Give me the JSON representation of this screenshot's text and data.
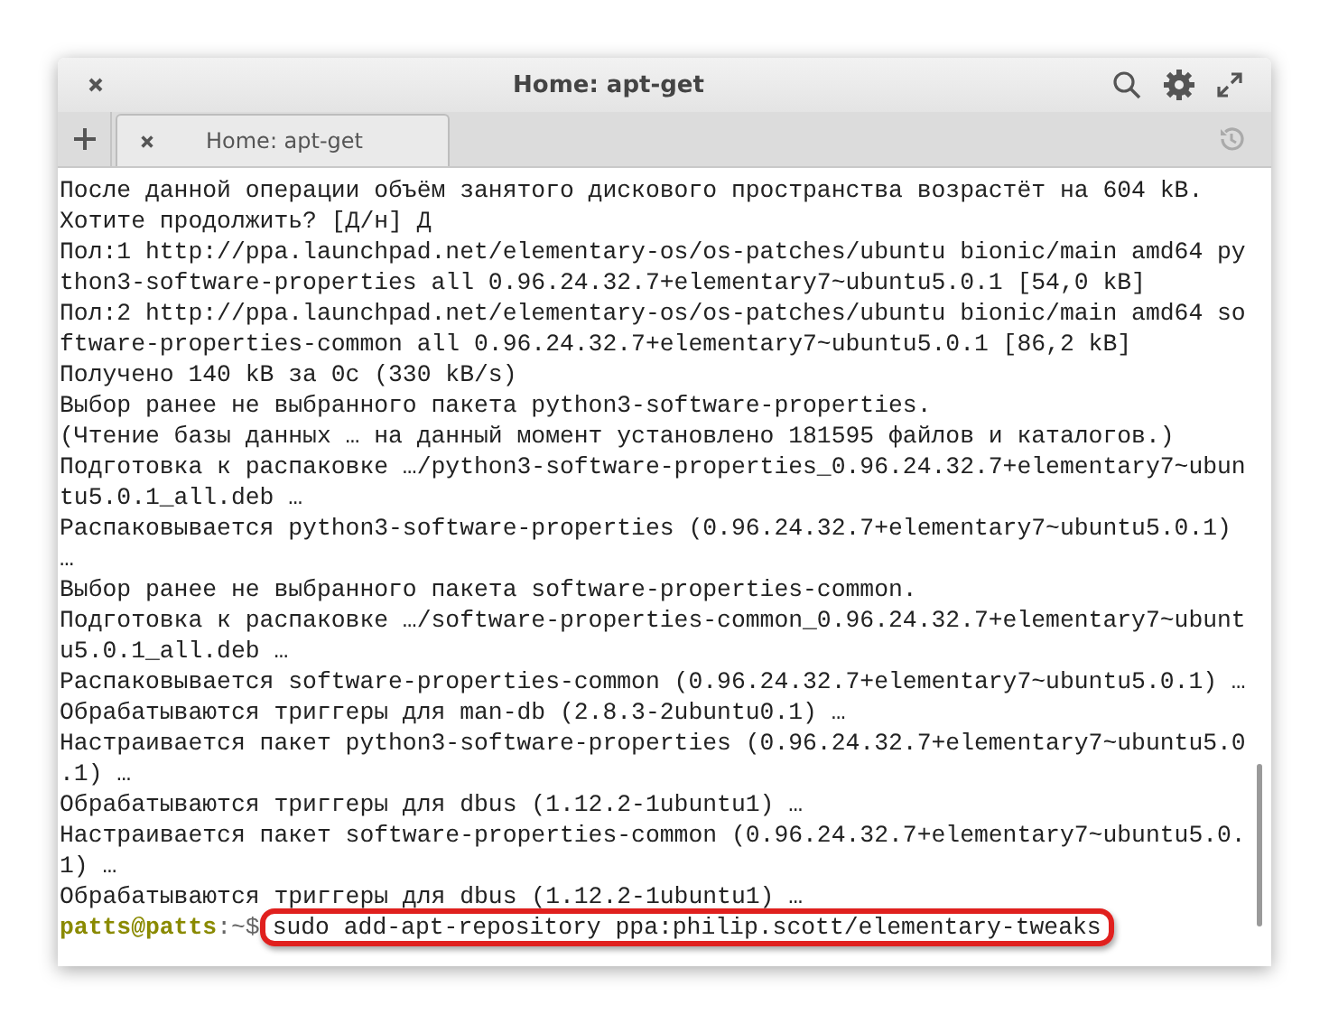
{
  "window": {
    "title": "Home: apt-get"
  },
  "tabs": [
    {
      "label": "Home: apt-get",
      "selected": true
    }
  ],
  "terminal": {
    "lines": [
      "После данной операции объём занятого дискового пространства возрастёт на 604 kB.",
      "Хотите продолжить? [Д/н] Д",
      "Пол:1 http://ppa.launchpad.net/elementary-os/os-patches/ubuntu bionic/main amd64 py",
      "thon3-software-properties all 0.96.24.32.7+elementary7~ubuntu5.0.1 [54,0 kB]",
      "Пол:2 http://ppa.launchpad.net/elementary-os/os-patches/ubuntu bionic/main amd64 so",
      "ftware-properties-common all 0.96.24.32.7+elementary7~ubuntu5.0.1 [86,2 kB]",
      "Получено 140 kB за 0c (330 kB/s)",
      "Выбор ранее не выбранного пакета python3-software-properties.",
      "(Чтение базы данных … на данный момент установлено 181595 файлов и каталогов.)",
      "Подготовка к распаковке …/python3-software-properties_0.96.24.32.7+elementary7~ubun",
      "tu5.0.1_all.deb …",
      "Распаковывается python3-software-properties (0.96.24.32.7+elementary7~ubuntu5.0.1)",
      "…",
      "Выбор ранее не выбранного пакета software-properties-common.",
      "Подготовка к распаковке …/software-properties-common_0.96.24.32.7+elementary7~ubunt",
      "u5.0.1_all.deb …",
      "Распаковывается software-properties-common (0.96.24.32.7+elementary7~ubuntu5.0.1) …",
      "Обрабатываются триггеры для man-db (2.8.3-2ubuntu0.1) …",
      "Настраивается пакет python3-software-properties (0.96.24.32.7+elementary7~ubuntu5.0",
      ".1) …",
      "Обрабатываются триггеры для dbus (1.12.2-1ubuntu1) …",
      "Настраивается пакет software-properties-common (0.96.24.32.7+elementary7~ubuntu5.0.",
      "1) …",
      "Обрабатываются триггеры для dbus (1.12.2-1ubuntu1) …"
    ],
    "prompt": {
      "user_host": "patts@patts",
      "path": ":~$",
      "command": "sudo add-apt-repository ppa:philip.scott/elementary-tweaks",
      "highlighted": true
    }
  }
}
